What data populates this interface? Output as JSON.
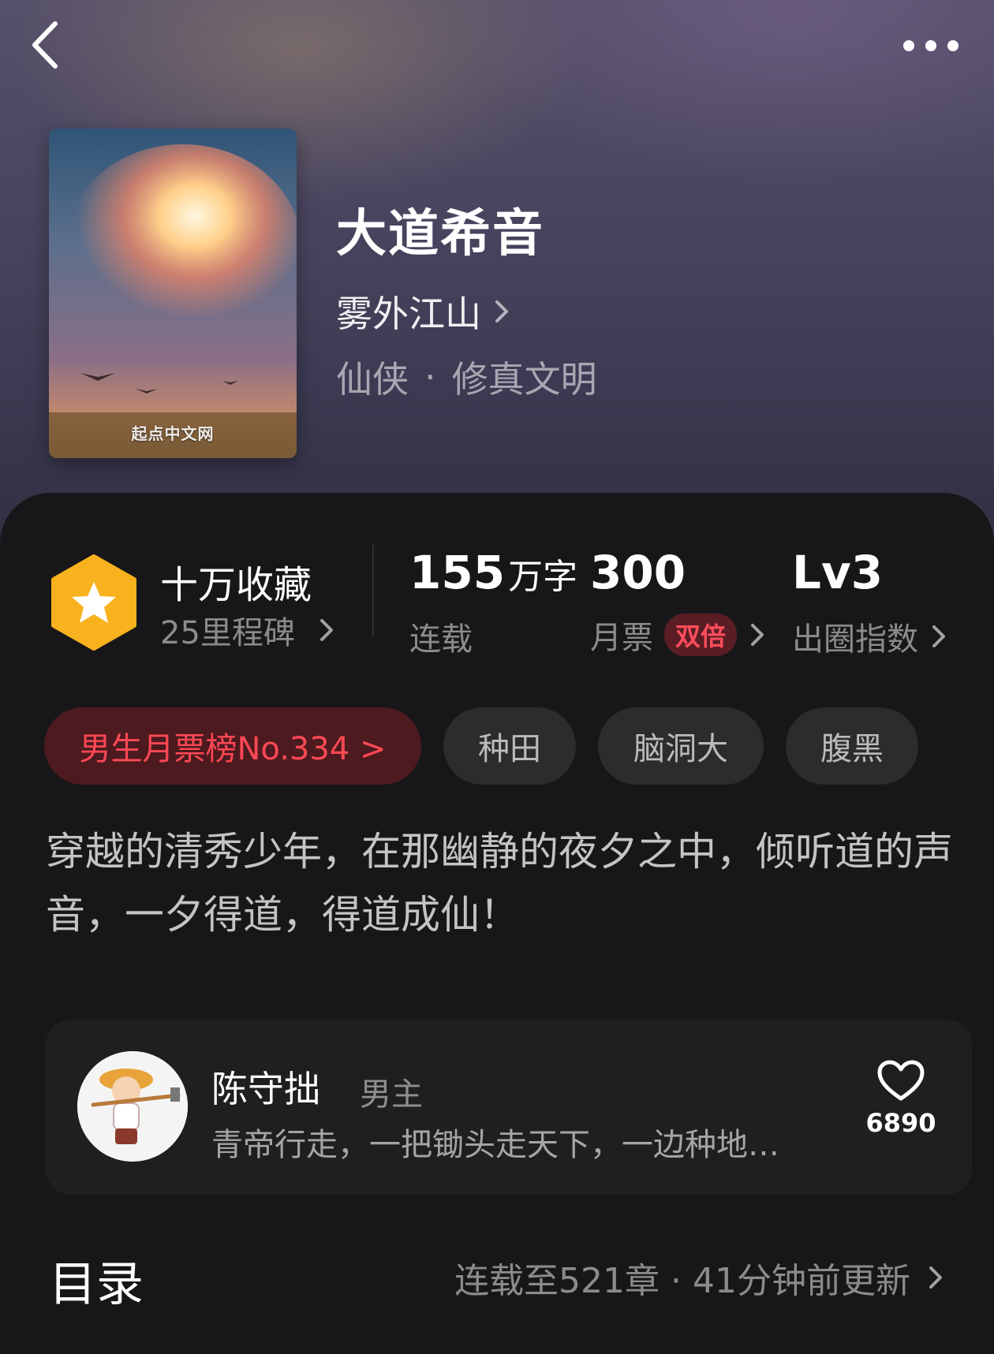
{
  "book": {
    "title": "大道希音",
    "author": "雾外江山",
    "genre": "仙侠",
    "subgenre": "修真文明",
    "cover_brand": "起点中文网"
  },
  "stats": {
    "favorites_title": "十万收藏",
    "milestones": "25里程碑",
    "word_count": "155",
    "word_unit": "万字",
    "word_label": "连载",
    "monthly_tickets": "300",
    "monthly_label": "月票",
    "double_badge": "双倍",
    "level": "Lv3",
    "level_label": "出圈指数"
  },
  "tags": [
    "男生月票榜No.334 >",
    "种田",
    "脑洞大",
    "腹黑"
  ],
  "intro": "穿越的清秀少年，在那幽静的夜夕之中，倾听道的声音，一夕得道，得道成仙！",
  "character": {
    "name": "陈守拙",
    "role": "男主",
    "description": "青帝行走，一把锄头走天下，一边种地…",
    "likes": "6890"
  },
  "toc": {
    "title": "目录",
    "status": "连载至521章 · 41分钟前更新"
  },
  "colors": {
    "accent_red": "#ff4855",
    "badge_yellow": "#f7b21e",
    "panel_bg": "#17171a"
  },
  "icons": [
    "back-icon",
    "more-icon",
    "star-badge-icon",
    "chevron-right-icon",
    "heart-icon"
  ]
}
